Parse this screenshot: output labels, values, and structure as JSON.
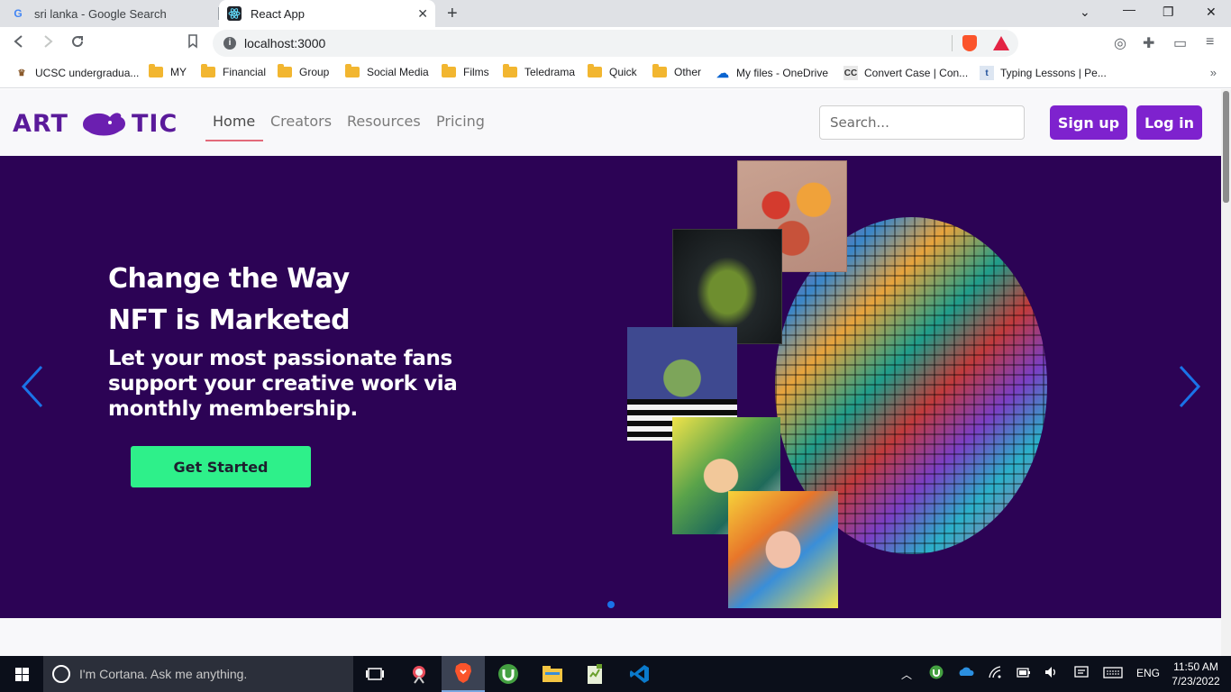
{
  "browser": {
    "tabs": [
      {
        "title": "sri lanka - Google Search",
        "favicon": "google-icon"
      },
      {
        "title": "React App",
        "favicon": "react-icon"
      }
    ],
    "url": "localhost:3000",
    "bookmarks": [
      {
        "label": "UCSC undergradua...",
        "icon": "ucsc-icon"
      },
      {
        "label": "MY",
        "icon": "folder-icon"
      },
      {
        "label": "Financial",
        "icon": "folder-icon"
      },
      {
        "label": "Group",
        "icon": "folder-icon"
      },
      {
        "label": "Social Media",
        "icon": "folder-icon"
      },
      {
        "label": "Films",
        "icon": "folder-icon"
      },
      {
        "label": "Teledrama",
        "icon": "folder-icon"
      },
      {
        "label": "Quick",
        "icon": "folder-icon"
      },
      {
        "label": "Other",
        "icon": "folder-icon"
      },
      {
        "label": "My files - OneDrive",
        "icon": "onedrive-icon"
      },
      {
        "label": "Convert Case | Con...",
        "icon": "convertcase-icon"
      },
      {
        "label": "Typing Lessons | Pe...",
        "icon": "typing-icon"
      }
    ]
  },
  "nav": {
    "logo": "ART TIC",
    "links": [
      "Home",
      "Creators",
      "Resources",
      "Pricing"
    ],
    "active": "Home",
    "search_placeholder": "Search...",
    "signup_label": "Sign up",
    "login_label": "Log in"
  },
  "hero": {
    "title_line1": "Change the Way",
    "title_line2": "NFT is Marketed",
    "subtitle": "Let your most passionate fans support your creative work via monthly membership.",
    "cta_label": "Get Started"
  },
  "taskbar": {
    "cortana_text": "I'm Cortana. Ask me anything.",
    "language": "ENG",
    "time": "11:50 AM",
    "date": "7/23/2022"
  },
  "colors": {
    "brand": "#7e22ce",
    "hero_bg": "#2c0355",
    "cta": "#2ef08a",
    "carousel_arrow": "#1a73e8"
  }
}
